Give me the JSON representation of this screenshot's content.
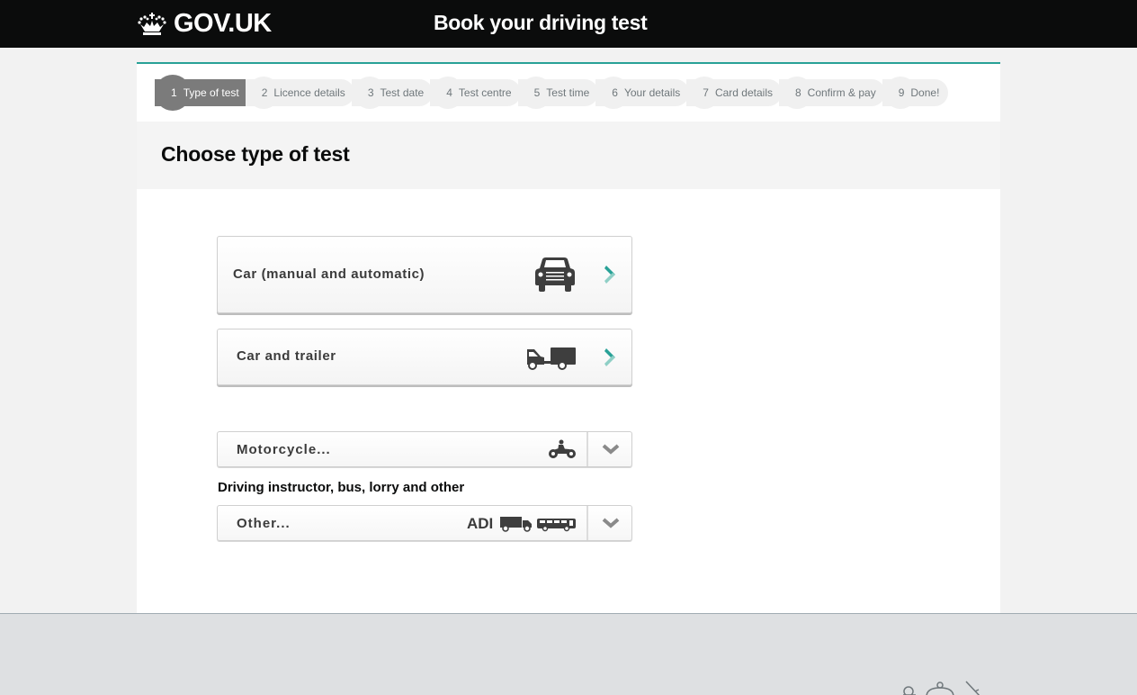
{
  "header": {
    "logo_text": "GOV.UK",
    "service_name": "Book your driving test"
  },
  "steps": [
    {
      "num": "1",
      "label": "Type of test",
      "active": true
    },
    {
      "num": "2",
      "label": "Licence details",
      "active": false
    },
    {
      "num": "3",
      "label": "Test date",
      "active": false
    },
    {
      "num": "4",
      "label": "Test centre",
      "active": false
    },
    {
      "num": "5",
      "label": "Test time",
      "active": false
    },
    {
      "num": "6",
      "label": "Your details",
      "active": false
    },
    {
      "num": "7",
      "label": "Card details",
      "active": false
    },
    {
      "num": "8",
      "label": "Confirm & pay",
      "active": false
    },
    {
      "num": "9",
      "label": "Done!",
      "active": false
    }
  ],
  "page": {
    "title": "Choose type of test"
  },
  "options": {
    "car": {
      "label": "Car (manual and automatic)",
      "icon": "car-icon"
    },
    "trailer": {
      "label": "Car and trailer",
      "icon": "car-trailer-icon"
    }
  },
  "selects": {
    "motorcycle": {
      "value": "Motorcycle...",
      "icon": "motorcycle-icon"
    },
    "other_heading": "Driving instructor, bus, lorry and other",
    "other": {
      "value": "Other...",
      "badge": "ADI",
      "icons": [
        "lorry-icon",
        "bus-icon"
      ]
    }
  },
  "colors": {
    "header_bg": "#0b0c0c",
    "accent_teal": "#28a197",
    "active_step": "#7b7b7b",
    "inactive_step": "#f0f0f0",
    "footer_bg": "#dee0e2"
  }
}
